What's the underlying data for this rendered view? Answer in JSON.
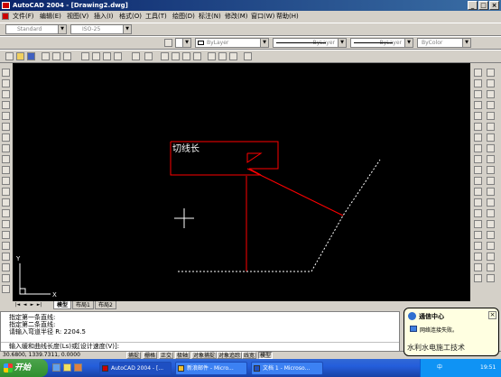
{
  "window": {
    "title": "AutoCAD 2004 - [Drawing2.dwg]",
    "min_glyph": "_",
    "max_glyph": "□",
    "close_glyph": "×"
  },
  "menu": {
    "items": [
      "文件(F)",
      "编辑(E)",
      "视图(V)",
      "插入(I)",
      "格式(O)",
      "工具(T)",
      "绘图(D)",
      "标注(N)",
      "修改(M)",
      "窗口(W)",
      "帮助(H)"
    ]
  },
  "toolbar": {
    "text_style": "Standard",
    "dim_style": "ISO-25",
    "layer": "ByLayer",
    "linetype": "ByLayer",
    "lineweight": "ByLayer",
    "plot_style": "ByColor",
    "arrow_glyph": "▼"
  },
  "drawing": {
    "callout_text": "切线长",
    "ucs_x": "X",
    "ucs_y": "Y",
    "colors": {
      "background": "#000000",
      "red_lines": "#ff0000",
      "dashed": "#ffffff",
      "crosshair": "#ffffff"
    }
  },
  "tabs": {
    "items": [
      "模型",
      "布局1",
      "布局2"
    ],
    "active": "模型",
    "nav": [
      "|◄",
      "◄",
      "►",
      "►|"
    ]
  },
  "command": {
    "lines": [
      "指定第一条直线:",
      "指定第二条直线:",
      "请输入弯道半径  R:   2204.5"
    ],
    "prompt": "输入缓和曲线长度(Ls)或[设计速度(V)]:"
  },
  "status": {
    "coords": "30.6800,  1339.7311, 0.0000",
    "toggles": [
      "捕捉",
      "栅格",
      "正交",
      "极轴",
      "对象捕捉",
      "对象追踪",
      "线宽",
      "模型"
    ],
    "active_toggles": [
      "模型"
    ]
  },
  "taskbar": {
    "start": "开始",
    "tasks": [
      "AutoCAD 2004 - [...",
      "新浪邮件 - Micro...",
      "文档 1 - Microso..."
    ],
    "active_task": 0,
    "lang": "中",
    "time": "19:51"
  },
  "notification": {
    "title": "通信中心",
    "message": "网络连接失败。",
    "close_glyph": "×",
    "watermark": "水利水电施工技术"
  }
}
